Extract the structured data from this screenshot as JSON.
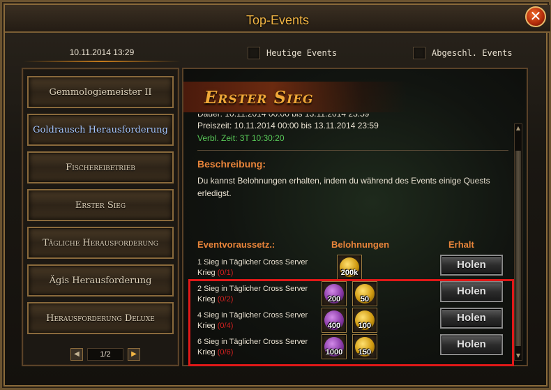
{
  "window": {
    "title": "Top-Events",
    "close_label": "✕"
  },
  "header": {
    "datetime": "10.11.2014 13:29",
    "filters": [
      {
        "label": "Heutige Events",
        "checked": false
      },
      {
        "label": "Abgeschl. Events",
        "checked": false
      }
    ]
  },
  "sidebar": {
    "items": [
      {
        "label": "Gemmologiemeister II",
        "selected": false
      },
      {
        "label": "Goldrausch Herausforderung",
        "selected": true
      },
      {
        "label": "Fischereibetrieb",
        "selected": false
      },
      {
        "label": "Erster Sieg",
        "selected": false
      },
      {
        "label": "Tägliche Herausforderung",
        "selected": false
      },
      {
        "label": "Ägis Herausforderung",
        "selected": false
      },
      {
        "label": "Herausforderung Deluxe",
        "selected": false
      }
    ],
    "pager": {
      "label": "1/2",
      "prev": "◀",
      "next": "▶"
    }
  },
  "event": {
    "title": "Erster Sieg",
    "cut_line": "Dauer: 10.11.2014 00:00 bis 13.11.2014 23:59",
    "prize_time": "Preiszeit: 10.11.2014 00:00 bis 13.11.2014 23:59",
    "remaining": "Verbl. Zeit: 3T 10:30:20",
    "description_title": "Beschreibung:",
    "description": "Du kannst Belohnungen erhalten, indem du während des Events einige Quests erledigst."
  },
  "table": {
    "headers": {
      "requirement": "Eventvoraussetz.:",
      "rewards": "Belohnungen",
      "claim": "Erhalt"
    },
    "rows": [
      {
        "requirement": "1 Sieg in Täglicher Cross Server Krieg",
        "progress": "(0/1)",
        "rewards": [
          {
            "qty": "200k",
            "color": "gold"
          }
        ],
        "claim_label": "Holen"
      },
      {
        "requirement": "2 Sieg in Täglicher Cross Server Krieg",
        "progress": "(0/2)",
        "rewards": [
          {
            "qty": "200",
            "color": "purple"
          },
          {
            "qty": "50",
            "color": "gold"
          }
        ],
        "claim_label": "Holen"
      },
      {
        "requirement": "4 Sieg in Täglicher Cross Server Krieg",
        "progress": "(0/4)",
        "rewards": [
          {
            "qty": "400",
            "color": "purple"
          },
          {
            "qty": "100",
            "color": "gold"
          }
        ],
        "claim_label": "Holen"
      },
      {
        "requirement": "6 Sieg in Täglicher Cross Server Krieg",
        "progress": "(0/6)",
        "rewards": [
          {
            "qty": "1000",
            "color": "purple"
          },
          {
            "qty": "150",
            "color": "gold"
          }
        ],
        "claim_label": "Holen"
      }
    ]
  },
  "colors": {
    "accent": "#f2b544",
    "section_heading": "#e8843a",
    "remaining_time": "#58c858",
    "progress": "#d02020",
    "highlight": "#e01818"
  }
}
